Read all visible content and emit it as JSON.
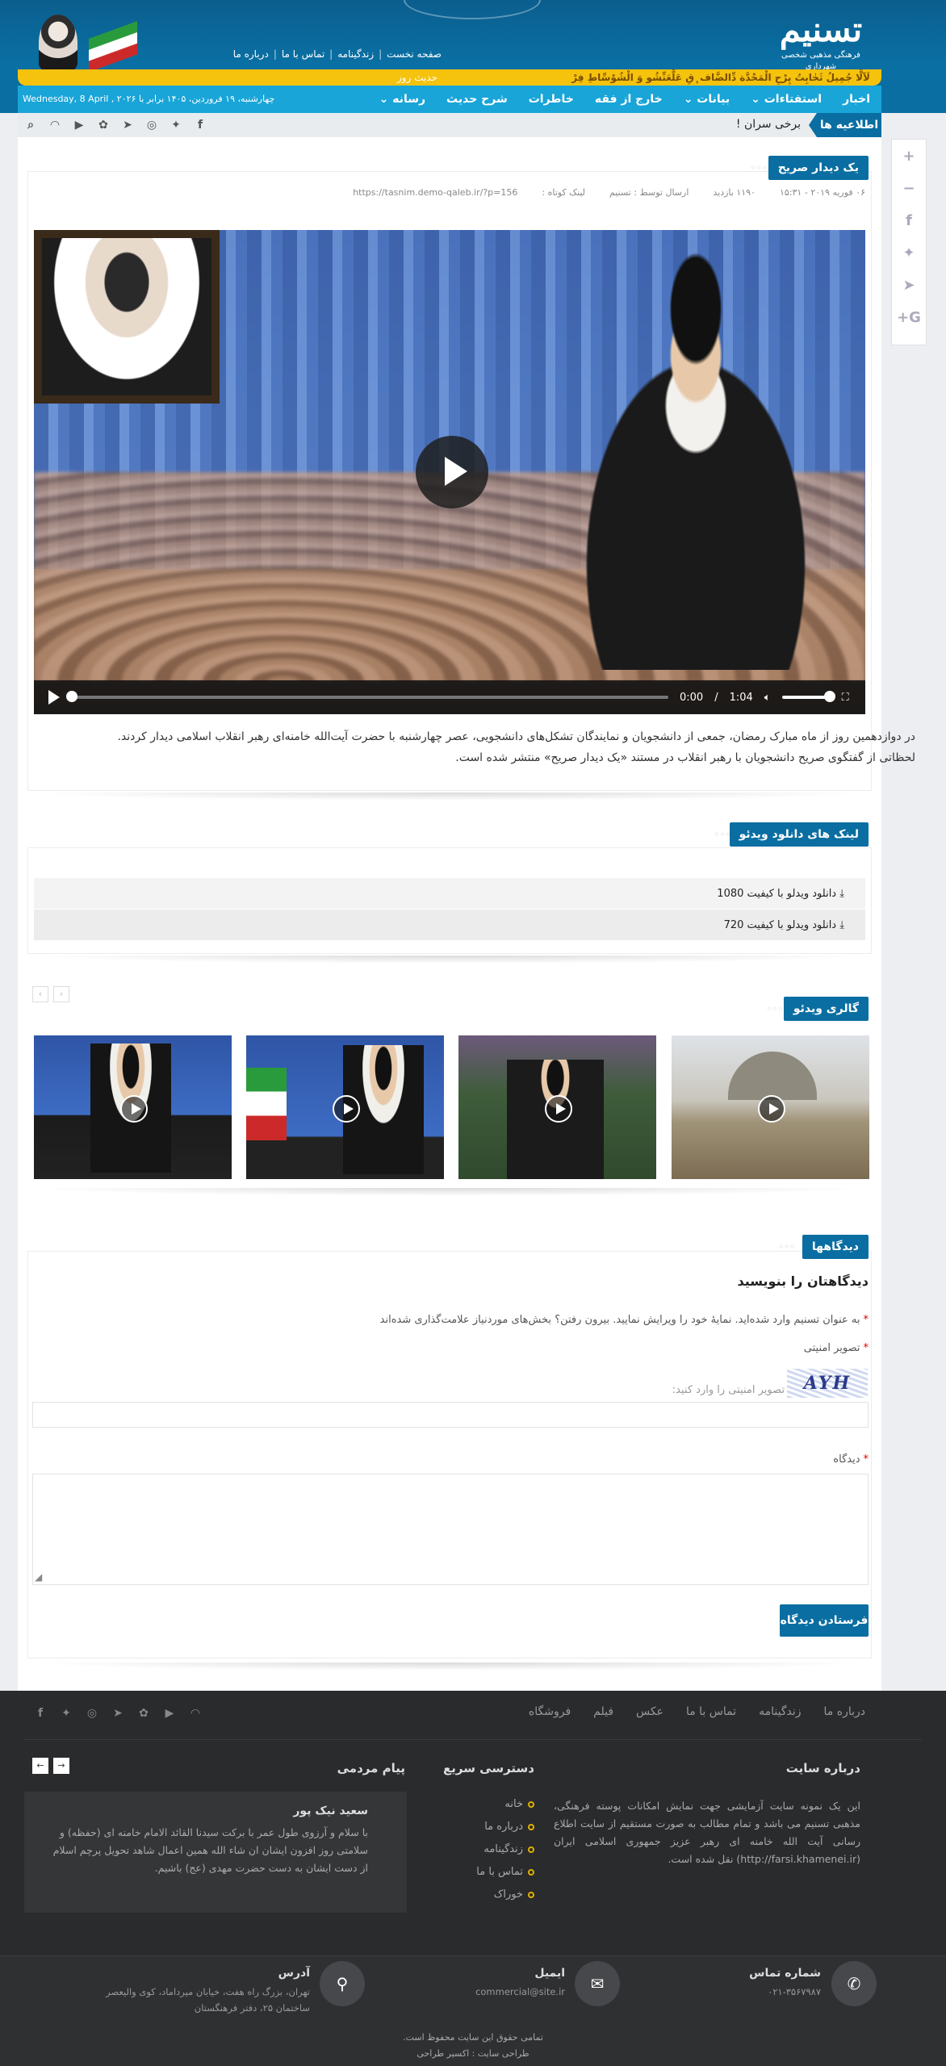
{
  "brand": {
    "logo_text": "تسنیم",
    "logo_sub": "فرهنگی مذهبی شخصی شهرداری"
  },
  "top_links": [
    "صفحه نخست",
    "زندگینامه",
    "تماس با ما",
    "درباره ما"
  ],
  "ticker": {
    "text": "لَآلَّا جُمِیلُ ثَحٰابِتُ پِرْحِ الْمَحْدَّة دِّالضَّاف ٖقِ عَلَّعَنِّشُو وَ الْشُوْسِّاطِ فِرْ",
    "label": "حدیث روز"
  },
  "nav": {
    "items": [
      "اخبار",
      "استفتاءات ⌄",
      "بیانات ⌄",
      "خارج از فقه",
      "خاطرات",
      "شرح حدیث",
      "رسانه ⌄"
    ],
    "date": "Wednesday, 8 April , ۲۰۲۶ چهارشنبه، ۱۹ فروردین، ۱۴۰۵ برابر با"
  },
  "notice": {
    "label": "اطلاعیه ها",
    "text": "برخی سران !"
  },
  "article": {
    "section_title": "یک دیدار صریح",
    "meta": {
      "date": "۰۶ فوریه ۲۰۱۹ - ۱۵:۳۱",
      "views": "۱۱۹۰ بازدید",
      "author": "ارسال توسط : تسنیم",
      "short_link_label": "لینک کوتاه :",
      "short_link": "https://tasnim.demo-qaleb.ir/?p=156"
    },
    "video": {
      "time_current": "0:00",
      "time_total": "1:04",
      "progress": 0,
      "volume": 1.0
    },
    "description": "در دوازدهمین روز از ماه مبارک رمضان، جمعی از دانشجویان و نمایندگان تشکل‌های دانشجویی، عصر چهارشنبه با حضرت آیت‌الله خامنه‌ای رهبر انقلاب اسلامی دیدار کردند. لحظاتی از گفتگوی صریح دانشجویان با رهبر انقلاب در مستند «یک دیدار صریح» منتشر شده است."
  },
  "downloads": {
    "section_title": "لینک های دانلود ویدئو",
    "items": [
      "دانلود ویدلو با کیفیت 1080",
      "دانلود ویدلو با کیفیت 720"
    ]
  },
  "gallery": {
    "section_title": "گالری ویدئو",
    "prev": "‹",
    "next": "›"
  },
  "comments": {
    "section_title": "دیدگاهها",
    "heading": "دیدگاهتان را بنویسید",
    "logged_in_text": "به عنوان تسنیم وارد شده‌اید. نمایهٔ خود را ویرایش نمایید. بیرون رفتن؟ بخش‌های موردنیاز علامت‌گذاری شده‌اند",
    "captcha_label": "تصویر امنیتی",
    "captcha_text": "AYH",
    "captcha_placeholder": "تصویر امنیتی را وارد کنید:",
    "comment_label": "دیدگاه",
    "submit": "فرستادن دیدگاه"
  },
  "footer": {
    "links": [
      "درباره ما",
      "زندگینامه",
      "تماس با ما",
      "عکس",
      "فیلم",
      "فروشگاه"
    ],
    "about_title": "درباره سایت",
    "about_text": "این یک نمونه سایت آزمایشی جهت نمایش امکانات پوسته فرهنگی، مذهبی تسنیم می باشد و تمام مطالب به صورت مستقیم از سایت اطلاع رسانی آیت الله خامنه ای رهبر عزیز جمهوری اسلامی ایران (http://farsi.khamenei.ir) نقل شده است.",
    "quick_title": "دسترسی سریع",
    "quick_links": [
      "خانه",
      "درباره ما",
      "زندگینامه",
      "تماس با ما",
      "خوراک"
    ],
    "msg_title": "پیام مردمی",
    "msg_author": "سعید نیک پور",
    "msg_text": "با سلام و آرزوی طول عمر با برکت سیدنا القائد الامام خامنه ای (حفظه) و سلامتی روز افزون ایشان ان شاء الله همین اعمال شاهد تحویل پرچم اسلام از دست ایشان به دست حضرت مهدی (عج) باشیم.",
    "contact": {
      "phone_title": "شماره تماس",
      "phone": "۰۲۱-۳۵۶۷۹۸۷",
      "email_title": "ایمیل",
      "email": "commercial@site.ir",
      "address_title": "آدرس",
      "address": "تهران، بزرگ راه هفت، خیابان میرداماد، کوی والیعصر ساختمان ۲۵، دفتر فرهنگستان"
    },
    "copyright": "تمامی حقوق این سایت محفوظ است.",
    "designer": "طراحی سایت : اکسیر طراحی"
  },
  "colors": {
    "primary": "#0a6ea2",
    "accent": "#19a5d8",
    "ticker": "#f5c20d"
  }
}
